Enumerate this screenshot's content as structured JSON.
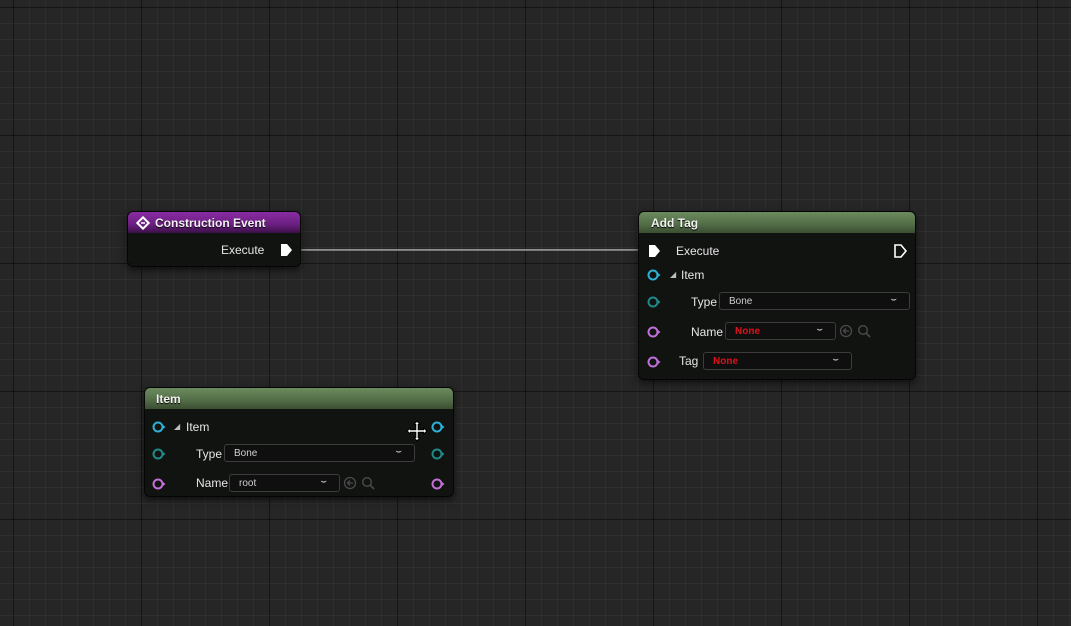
{
  "construction_event": {
    "title": "Construction Event",
    "execute_label": "Execute"
  },
  "add_tag": {
    "title": "Add Tag",
    "execute_label": "Execute",
    "item_label": "Item",
    "type_label": "Type",
    "type_value": "Bone",
    "name_label": "Name",
    "name_value": "None",
    "tag_label": "Tag",
    "tag_value": "None"
  },
  "item_node": {
    "title": "Item",
    "item_label": "Item",
    "type_label": "Type",
    "type_value": "Bone",
    "name_label": "Name",
    "name_value": "root"
  },
  "colors": {
    "struct_pin": "#2fb0d6",
    "struct_pin_dim": "#1f8a8a",
    "name_pin": "#c070d8",
    "exec_pin": "#ffffff",
    "none_value": "#e0101a"
  },
  "icons": {
    "event": "event-diamond-icon",
    "exec": "exec-pin-icon",
    "struct": "struct-pin-icon",
    "name": "name-pin-icon",
    "browse": "use-selected-arrow-icon",
    "search": "search-icon",
    "cursor": "move-cursor-icon"
  }
}
